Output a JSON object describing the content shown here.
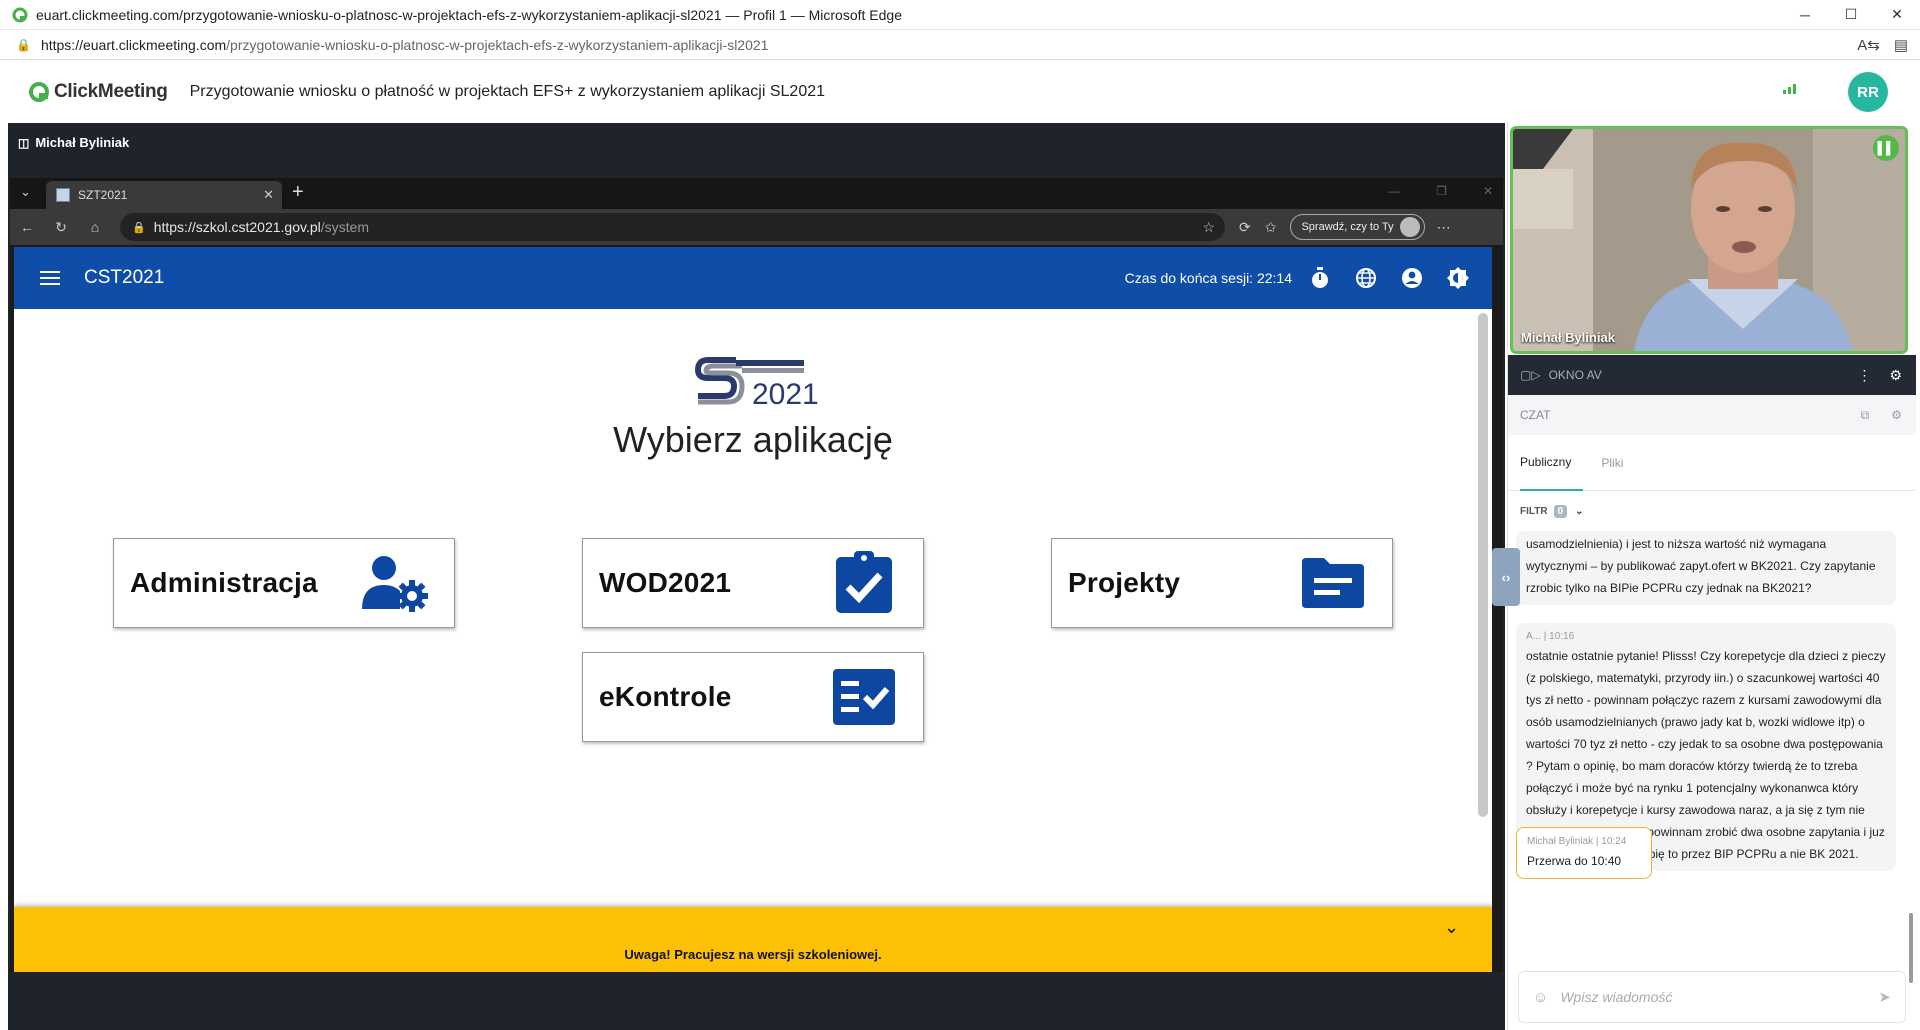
{
  "window": {
    "title": "euart.clickmeeting.com/przygotowanie-wniosku-o-platnosc-w-projektach-efs-z-wykorzystaniem-aplikacji-sl2021 — Profil 1 — Microsoft Edge",
    "url_host": "https://euart.clickmeeting.com",
    "url_path": "/przygotowanie-wniosku-o-platnosc-w-projektach-efs-z-wykorzystaniem-aplikacji-sl2021",
    "min": "─",
    "max": "☐",
    "close": "✕"
  },
  "clickmeeting": {
    "brand": "ClickMeeting",
    "event_title": "Przygotowanie wniosku o płatność w projektach EFS+ z wykorzystaniem aplikacji SL2021",
    "user_initials": "RR",
    "brand_color": "#46b04a"
  },
  "stage": {
    "presenter": "Michał Byliniak"
  },
  "inner_browser": {
    "tab_title": "SZT2021",
    "tab_close": "✕",
    "new_tab": "+",
    "url_host": "https://szkol.cst2021.gov.pl",
    "url_path": "/system",
    "profile_label": "Sprawdź, czy to Ty"
  },
  "app": {
    "title": "CST2021",
    "session_label": "Czas do końca sesji: 22:14",
    "logo_text": "2021",
    "heading": "Wybierz aplikację",
    "tiles": [
      {
        "label": "Administracja",
        "icon": "user-gear-icon"
      },
      {
        "label": "WOD2021",
        "icon": "clipboard-check-icon"
      },
      {
        "label": "Projekty",
        "icon": "folder-icon"
      },
      {
        "label": "eKontrole",
        "icon": "checklist-icon"
      }
    ],
    "warning": "Uwaga! Pracujesz na wersji szkoleniowej.",
    "bar_color": "#0f4ea8",
    "tile_icon_color": "#0d47a1",
    "warning_color": "#fcc104"
  },
  "side": {
    "video_name": "Michał Byliniak",
    "av_label": "OKNO AV",
    "chat_label": "CZAT",
    "tab_public": "Publiczny",
    "tab_files": "Pliki",
    "filter_label": "FILTR",
    "filter_count": "0",
    "messages": [
      {
        "meta": "",
        "lines": [
          "usamodzielnienia) i jest to niższa wartość niż wymagana",
          "wytycznymi – by publikować zapyt.ofert w BK2021. Czy zapytanie",
          "rzrobic tylko na BIPie PCPRu czy jednak na BK2021?"
        ]
      },
      {
        "meta": "A...  |  10:16",
        "lines": [
          "ostatnie ostatnie pytanie! Plisss! Czy korepetycje dla dzieci z pieczy",
          "(z polskiego, matematyki, przyrody iin.) o szacunkowej wartości 40",
          "tys zł netto - powinnam połączyc razem z kursami zawodowymi dla",
          "osób usamodzielnianych (prawo jady kat b, wozki widlowe itp) o",
          "wartości 70 tyz zł netto - czy  jedak to sa osobne dwa postępowania",
          "? Pytam o opinię, bo mam doraców którzy twierdą że to tzreba",
          "połączyć i może być na rynku 1 potencjalny wykonanwca który",
          "obsłuży i korepetycje i kursy zawodowa naraz, a ja się z tym nie",
          "zgadzam. Uważam że powinnam zrobić dwa osobne zapytania i juz",
          "wiem (dziekuję!) ze zrobię to przez BIP PCPRu a nie BK 2021."
        ]
      },
      {
        "meta": "Michał Byliniak  |  10:24",
        "lines": [
          "Przerwa do 10:40"
        ]
      }
    ],
    "input_placeholder": "Wpisz wiadomość"
  }
}
